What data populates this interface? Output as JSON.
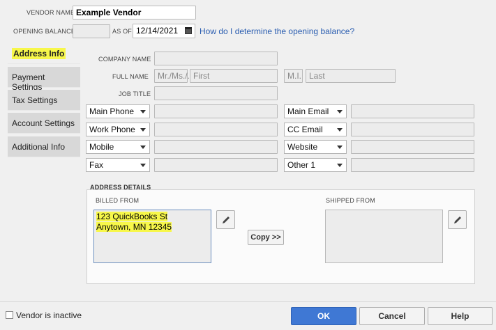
{
  "vendor_name": {
    "label": "VENDOR NAME",
    "value": "Example Vendor"
  },
  "opening_balance": {
    "label": "OPENING BALANCE",
    "value": "",
    "as_of_label": "AS OF",
    "date": "12/14/2021",
    "help_link": "How do I determine the opening balance?"
  },
  "tabs": [
    {
      "label": "Address Info",
      "active": true
    },
    {
      "label": "Payment Settings"
    },
    {
      "label": "Tax Settings"
    },
    {
      "label": "Account Settings"
    },
    {
      "label": "Additional Info"
    }
  ],
  "form": {
    "company_name_label": "COMPANY NAME",
    "full_name_label": "FULL NAME",
    "job_title_label": "JOB TITLE",
    "mr_placeholder": "Mr./Ms./...",
    "first_placeholder": "First",
    "mi_placeholder": "M.I.",
    "last_placeholder": "Last",
    "left_contacts": [
      "Main Phone",
      "Work Phone",
      "Mobile",
      "Fax"
    ],
    "right_contacts": [
      "Main Email",
      "CC Email",
      "Website",
      "Other 1"
    ]
  },
  "address": {
    "section_label": "ADDRESS DETAILS",
    "billed_label": "BILLED FROM",
    "billed_line1": "123 QuickBooks St",
    "billed_line2": "Anytown, MN 12345",
    "shipped_label": "SHIPPED FROM",
    "copy_button": "Copy >>"
  },
  "footer": {
    "inactive_label": "Vendor is inactive",
    "ok": "OK",
    "cancel": "Cancel",
    "help": "Help"
  },
  "colors": {
    "highlight": "#f7f74a",
    "primary_button": "#3f78d4",
    "link": "#2a5db0"
  }
}
